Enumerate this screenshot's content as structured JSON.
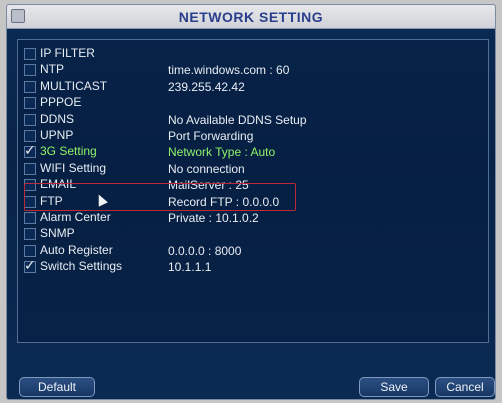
{
  "window": {
    "title": "NETWORK SETTING"
  },
  "items": [
    {
      "name": "IP FILTER",
      "value": "",
      "checked": false,
      "selected": false
    },
    {
      "name": "NTP",
      "value": "time.windows.com : 60",
      "checked": false,
      "selected": false
    },
    {
      "name": "MULTICAST",
      "value": "239.255.42.42",
      "checked": false,
      "selected": false
    },
    {
      "name": "PPPOE",
      "value": "",
      "checked": false,
      "selected": false
    },
    {
      "name": "DDNS",
      "value": "No Available DDNS Setup",
      "checked": false,
      "selected": false
    },
    {
      "name": "UPNP",
      "value": "Port Forwarding",
      "checked": false,
      "selected": false
    },
    {
      "name": "3G Setting",
      "value": "Network Type : Auto",
      "checked": true,
      "selected": true
    },
    {
      "name": "WIFI Setting",
      "value": "No connection",
      "checked": false,
      "selected": false
    },
    {
      "name": "EMAIL",
      "value": "MailServer : 25",
      "checked": false,
      "selected": false
    },
    {
      "name": "FTP",
      "value": "Record FTP : 0.0.0.0",
      "checked": false,
      "selected": false
    },
    {
      "name": "Alarm Center",
      "value": "Private : 10.1.0.2",
      "checked": false,
      "selected": false
    },
    {
      "name": "SNMP",
      "value": "",
      "checked": false,
      "selected": false
    },
    {
      "name": "Auto Register",
      "value": "0.0.0.0 : 8000",
      "checked": false,
      "selected": false
    },
    {
      "name": "Switch Settings",
      "value": "10.1.1.1",
      "checked": true,
      "selected": false
    }
  ],
  "buttons": {
    "default_label": "Default",
    "save_label": "Save",
    "cancel_label": "Cancel"
  },
  "colors": {
    "background": "#082348",
    "selected_text": "#8ff26a",
    "highlight_border": "#c0283a",
    "title_text": "#2a3e8c"
  }
}
